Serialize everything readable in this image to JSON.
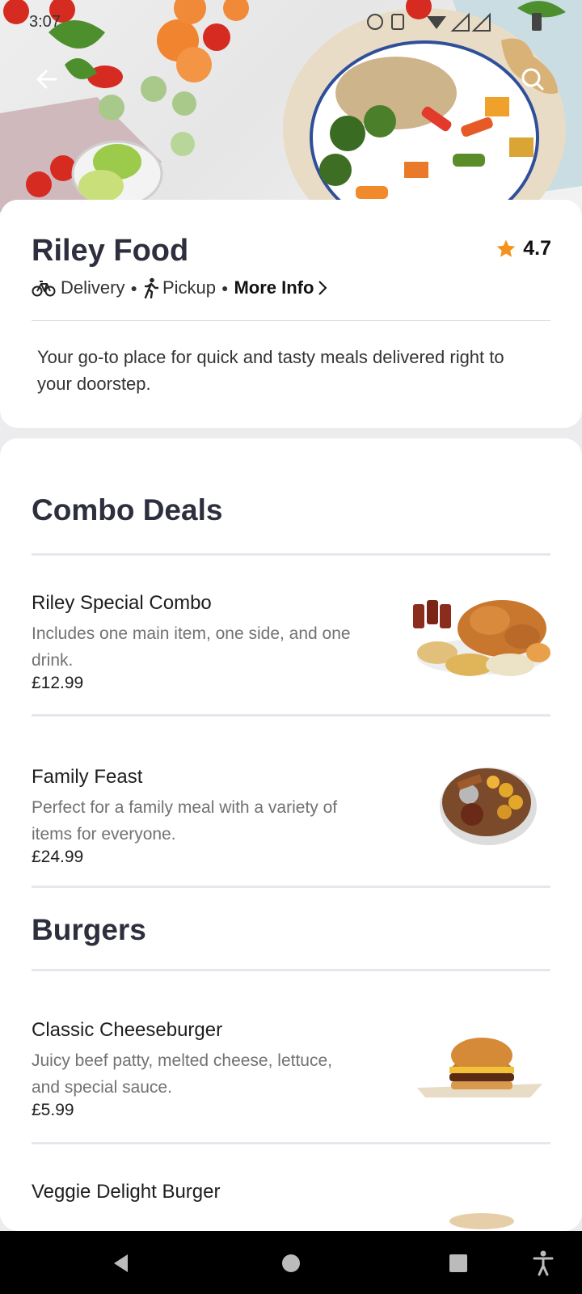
{
  "status_bar": {
    "time": "3:07"
  },
  "hero": {
    "back_icon": "arrow-left-icon",
    "share_icon": "share-icon",
    "search_icon": "search-icon"
  },
  "restaurant": {
    "name": "Riley Food",
    "rating": "4.7",
    "delivery_label": "Delivery",
    "pickup_label": "Pickup",
    "more_info_label": "More Info",
    "description": "Your go-to place for quick and tasty meals delivered right to your doorstep."
  },
  "sections": [
    {
      "title": "Combo Deals",
      "items": [
        {
          "name": "Riley Special Combo",
          "description": "Includes one main item, one side, and one drink.",
          "price": "£12.99"
        },
        {
          "name": "Family Feast",
          "description": "Perfect for a family meal with a variety of items for everyone.",
          "price": "£24.99"
        }
      ]
    },
    {
      "title": "Burgers",
      "items": [
        {
          "name": "Classic Cheeseburger",
          "description": "Juicy beef patty, melted cheese, lettuce, and special sauce.",
          "price": "£5.99"
        },
        {
          "name": "Veggie Delight Burger",
          "description": "",
          "price": ""
        }
      ]
    }
  ],
  "colors": {
    "accent_star": "#f5921e",
    "heading": "#2d2f3e",
    "muted_text": "#727272"
  }
}
